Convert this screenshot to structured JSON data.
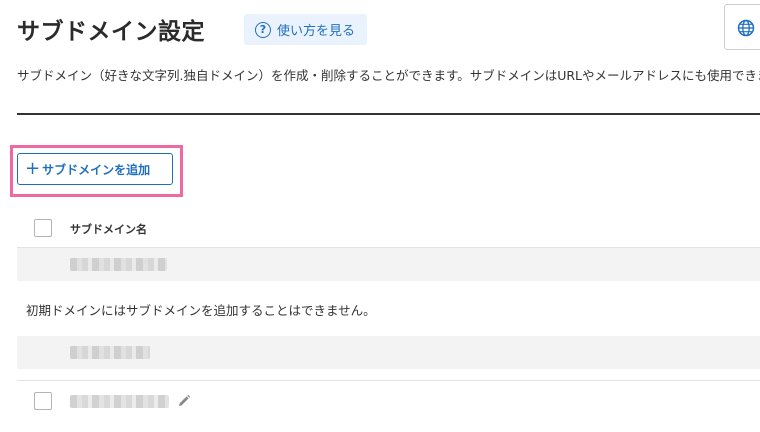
{
  "page": {
    "title": "サブドメイン設定",
    "help_label": "使い方を見る",
    "description": "サブドメイン（好きな文字列.独自ドメイン）を作成・削除することができます。サブドメインはURLやメールアドレスにも使用できます。"
  },
  "toolbar": {
    "add_subdomain_label": "サブドメインを追加"
  },
  "table": {
    "column_header": "サブドメイン名",
    "notice": "初期ドメインにはサブドメインを追加することはできません。"
  },
  "icons": {
    "help": "question-circle-icon",
    "language": "globe-icon",
    "add": "plus-icon",
    "edit": "pencil-icon"
  },
  "colors": {
    "accent": "#1f6fbf",
    "highlight": "#ef6aa2",
    "help_bg": "#eaf3fd",
    "row_bg": "#f3f3f3"
  }
}
